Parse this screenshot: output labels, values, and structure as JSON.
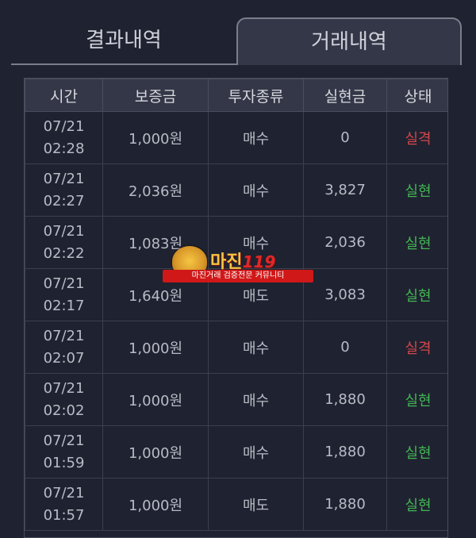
{
  "tabs": [
    {
      "label": "결과내역",
      "active": false
    },
    {
      "label": "거래내역",
      "active": true
    }
  ],
  "table": {
    "headers": [
      "시간",
      "보증금",
      "투자종류",
      "실현금",
      "상태"
    ],
    "rows": [
      {
        "date": "07/21",
        "time": "02:28",
        "deposit": "1,000원",
        "type": "매수",
        "realized": "0",
        "status": "실격"
      },
      {
        "date": "07/21",
        "time": "02:27",
        "deposit": "2,036원",
        "type": "매수",
        "realized": "3,827",
        "status": "실현"
      },
      {
        "date": "07/21",
        "time": "02:22",
        "deposit": "1,083원",
        "type": "매수",
        "realized": "2,036",
        "status": "실현"
      },
      {
        "date": "07/21",
        "time": "02:17",
        "deposit": "1,640원",
        "type": "매도",
        "realized": "3,083",
        "status": "실현"
      },
      {
        "date": "07/21",
        "time": "02:07",
        "deposit": "1,000원",
        "type": "매수",
        "realized": "0",
        "status": "실격"
      },
      {
        "date": "07/21",
        "time": "02:02",
        "deposit": "1,000원",
        "type": "매수",
        "realized": "1,880",
        "status": "실현"
      },
      {
        "date": "07/21",
        "time": "01:59",
        "deposit": "1,000원",
        "type": "매수",
        "realized": "1,880",
        "status": "실현"
      },
      {
        "date": "07/21",
        "time": "01:57",
        "deposit": "1,000원",
        "type": "매도",
        "realized": "1,880",
        "status": "실현"
      }
    ]
  },
  "watermark": {
    "title": "마진",
    "suffix": "119",
    "banner": "마진거래 검증전문 커뮤니티"
  },
  "colors": {
    "status_fail": "#d4474b",
    "status_ok": "#43b654",
    "background": "#1f2230"
  }
}
